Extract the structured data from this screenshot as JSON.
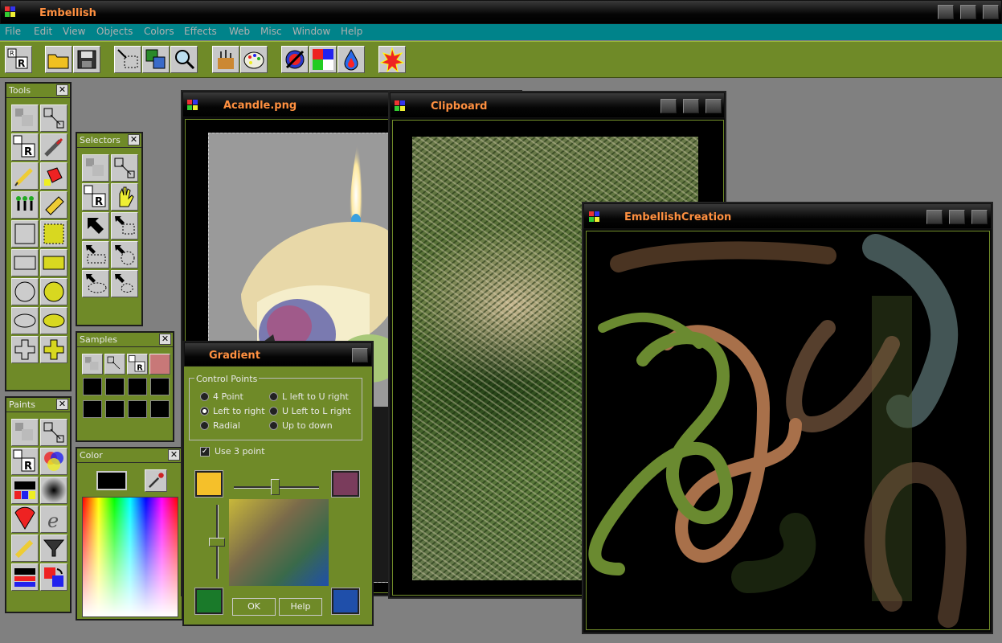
{
  "app": {
    "title": "Embellish"
  },
  "menu": [
    "File",
    "Edit",
    "View",
    "Objects",
    "Colors",
    "Effects",
    "Web",
    "Misc",
    "Window",
    "Help"
  ],
  "toolbar": {
    "icons": [
      "random-icon",
      "open-folder-icon",
      "save-icon",
      "selection-icon",
      "copy-icon",
      "zoom-icon",
      "paint-palette-icon",
      "color-palette-icon",
      "no-fill-icon",
      "color-grid-icon",
      "ink-drop-icon",
      "burst-icon"
    ]
  },
  "panels": {
    "tools": {
      "title": "Tools"
    },
    "selectors": {
      "title": "Selectors"
    },
    "samples": {
      "title": "Samples"
    },
    "paints": {
      "title": "Paints"
    },
    "color": {
      "title": "Color",
      "swatch": "#000000"
    }
  },
  "windows": {
    "candle": {
      "title": "Acandle.png"
    },
    "clipboard": {
      "title": "Clipboard"
    },
    "creation": {
      "title": "EmbellishCreation"
    }
  },
  "gradient": {
    "title": "Gradient",
    "group_label": "Control Points",
    "options": [
      {
        "label": "4 Point",
        "selected": false
      },
      {
        "label": "L left to U right",
        "selected": false
      },
      {
        "label": "Left to right",
        "selected": true
      },
      {
        "label": "U Left to L right",
        "selected": false
      },
      {
        "label": "Radial",
        "selected": false
      },
      {
        "label": "Up to down",
        "selected": false
      }
    ],
    "use3_label": "Use 3 point",
    "use3_checked": true,
    "colors": {
      "top_left": "#f5c02a",
      "top_right": "#7a3c5c",
      "bottom_left": "#1a7a2a",
      "bottom_right": "#1f4faa"
    },
    "ok_label": "OK",
    "help_label": "Help"
  },
  "theme": {
    "accent_green": "#6f8a28",
    "menu_teal": "#00838a",
    "title_orange": "#ff9040"
  }
}
